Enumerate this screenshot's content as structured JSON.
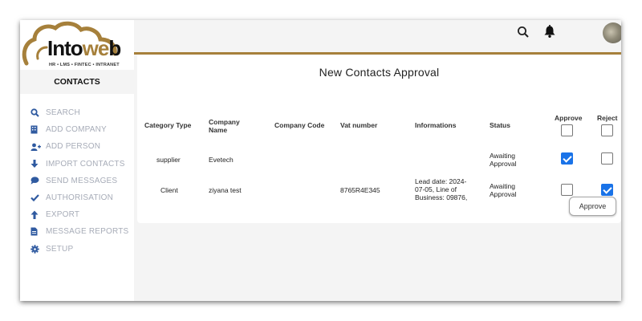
{
  "brand": {
    "name_part1": "Into",
    "name_part2": "we",
    "name_part3": "b",
    "tagline": "HR • LMS • FINTEC • INTRANET",
    "gold_color": "#a6803b"
  },
  "sidebar": {
    "section_title": "CONTACTS",
    "items": [
      {
        "label": "SEARCH",
        "icon": "search-icon"
      },
      {
        "label": "ADD COMPANY",
        "icon": "building-icon"
      },
      {
        "label": "ADD PERSON",
        "icon": "add-person-icon"
      },
      {
        "label": "IMPORT CONTACTS",
        "icon": "download-arrow-icon"
      },
      {
        "label": "SEND MESSAGES",
        "icon": "speech-bubble-icon"
      },
      {
        "label": "AUTHORISATION",
        "icon": "checkmark-icon"
      },
      {
        "label": "EXPORT",
        "icon": "upload-arrow-icon"
      },
      {
        "label": "MESSAGE REPORTS",
        "icon": "document-icon"
      },
      {
        "label": "SETUP",
        "icon": "gear-icon"
      }
    ]
  },
  "header": {
    "search_icon": "search-icon",
    "notification_icon": "bell-icon"
  },
  "main": {
    "title": "New Contacts Approval",
    "columns": {
      "category_type": "Category Type",
      "company_name": "Company Name",
      "company_code": "Company Code",
      "vat_number": "Vat number",
      "informations": "Informations",
      "status": "Status",
      "approve": "Approve",
      "reject": "Reject"
    },
    "header_approve_checked": false,
    "header_reject_checked": false,
    "rows": [
      {
        "category_type": "supplier",
        "company_name": "Evetech",
        "company_code": "",
        "vat_number": "",
        "informations": "",
        "status": "Awaiting Approval",
        "approve_checked": true,
        "reject_checked": false
      },
      {
        "category_type": "Client",
        "company_name": "ziyana test",
        "company_code": "",
        "vat_number": "8765R4E345",
        "informations": "Lead date: 2024-07-05, Line of Business: 09876,",
        "status": "Awaiting Approval",
        "approve_checked": false,
        "reject_checked": true
      }
    ],
    "approve_button_label": "Approve",
    "checkbox_color": "#1a73e8"
  }
}
